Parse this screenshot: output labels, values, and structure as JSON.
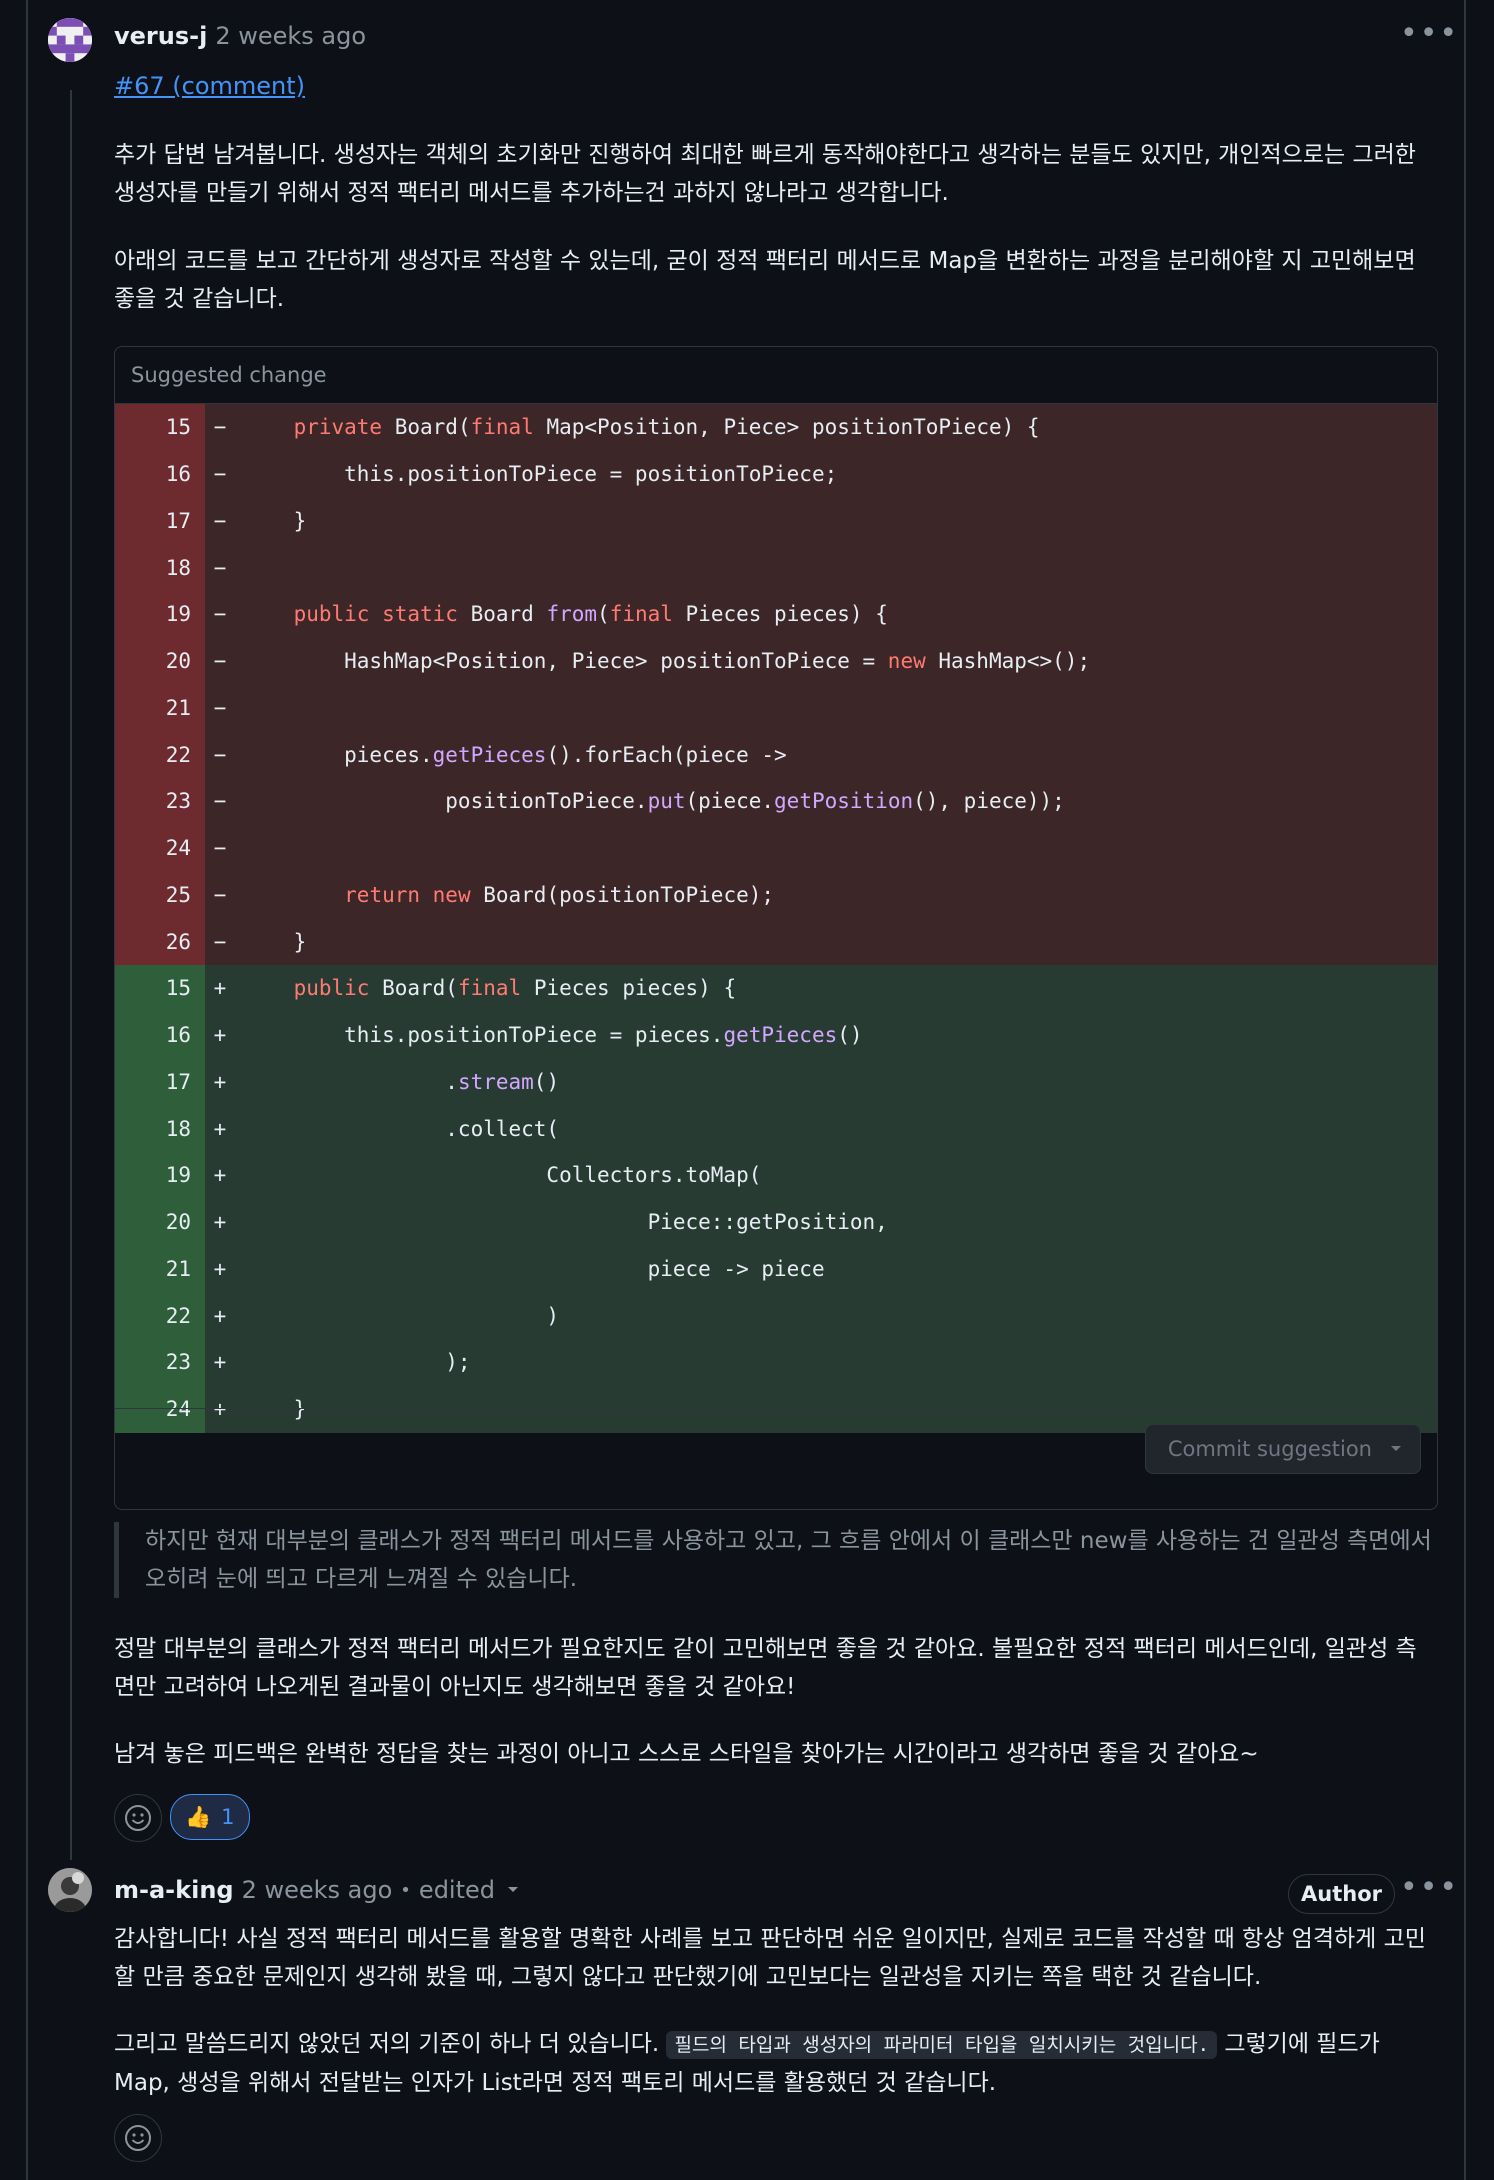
{
  "comment1": {
    "author": "verus-j",
    "time": "2 weeks ago",
    "link": "#67 (comment)",
    "para1": "추가 답변 남겨봅니다. 생성자는 객체의 초기화만 진행하여 최대한 빠르게 동작해야한다고 생각하는 분들도 있지만, 개인적으로는 그러한 생성자를 만들기 위해서 정적 팩터리 메서드를 추가하는건 과하지 않나라고 생각합니다.",
    "para2": "아래의 코드를 보고 간단하게 생성자로 작성할 수 있는데, 굳이 정적 팩터리 메서드로 Map을 변환하는 과정을 분리해야할 지 고민해보면 좋을 것 같습니다.",
    "suggestion": {
      "header": "Suggested change",
      "lines": [
        {
          "n": "15",
          "s": "−",
          "type": "del",
          "parts": [
            [
              "    ",
              ""
            ],
            [
              "private ",
              "kw"
            ],
            [
              "Board(",
              ""
            ],
            [
              "final ",
              "kw"
            ],
            [
              "Map<Position, Piece> positionToPiece) {",
              ""
            ]
          ]
        },
        {
          "n": "16",
          "s": "−",
          "type": "del",
          "parts": [
            [
              "        this.positionToPiece = positionToPiece;",
              ""
            ]
          ]
        },
        {
          "n": "17",
          "s": "−",
          "type": "del",
          "parts": [
            [
              "    }",
              ""
            ]
          ]
        },
        {
          "n": "18",
          "s": "−",
          "type": "del",
          "parts": [
            [
              "",
              ""
            ]
          ]
        },
        {
          "n": "19",
          "s": "−",
          "type": "del",
          "parts": [
            [
              "    ",
              ""
            ],
            [
              "public static ",
              "kw"
            ],
            [
              "Board ",
              ""
            ],
            [
              "from",
              "fn"
            ],
            [
              "(",
              ""
            ],
            [
              "final ",
              "kw"
            ],
            [
              "Pieces pieces) {",
              ""
            ]
          ]
        },
        {
          "n": "20",
          "s": "−",
          "type": "del",
          "parts": [
            [
              "        HashMap<Position, Piece> positionToPiece = ",
              ""
            ],
            [
              "new ",
              "kw"
            ],
            [
              "HashMap<>();",
              ""
            ]
          ]
        },
        {
          "n": "21",
          "s": "−",
          "type": "del",
          "parts": [
            [
              "",
              ""
            ]
          ]
        },
        {
          "n": "22",
          "s": "−",
          "type": "del",
          "parts": [
            [
              "        pieces.",
              ""
            ],
            [
              "getPieces",
              "fn"
            ],
            [
              "().forEach(piece ->",
              ""
            ]
          ]
        },
        {
          "n": "23",
          "s": "−",
          "type": "del",
          "parts": [
            [
              "                positionToPiece.",
              ""
            ],
            [
              "put",
              "fn"
            ],
            [
              "(piece.",
              ""
            ],
            [
              "getPosition",
              "fn"
            ],
            [
              "(), piece));",
              ""
            ]
          ]
        },
        {
          "n": "24",
          "s": "−",
          "type": "del",
          "parts": [
            [
              "",
              ""
            ]
          ]
        },
        {
          "n": "25",
          "s": "−",
          "type": "del",
          "parts": [
            [
              "        ",
              ""
            ],
            [
              "return new ",
              "kw"
            ],
            [
              "Board(positionToPiece);",
              ""
            ]
          ]
        },
        {
          "n": "26",
          "s": "−",
          "type": "del",
          "parts": [
            [
              "    }",
              ""
            ]
          ]
        },
        {
          "n": "15",
          "s": "+",
          "type": "add",
          "parts": [
            [
              "    ",
              ""
            ],
            [
              "public ",
              "kw"
            ],
            [
              "Board(",
              ""
            ],
            [
              "final ",
              "kw"
            ],
            [
              "Pieces pieces) {",
              ""
            ]
          ]
        },
        {
          "n": "16",
          "s": "+",
          "type": "add",
          "parts": [
            [
              "        this.positionToPiece = pieces.",
              ""
            ],
            [
              "getPieces",
              "fn"
            ],
            [
              "()",
              ""
            ]
          ]
        },
        {
          "n": "17",
          "s": "+",
          "type": "add",
          "parts": [
            [
              "                .",
              ""
            ],
            [
              "stream",
              "fn"
            ],
            [
              "()",
              ""
            ]
          ]
        },
        {
          "n": "18",
          "s": "+",
          "type": "add",
          "parts": [
            [
              "                .collect(",
              ""
            ]
          ]
        },
        {
          "n": "19",
          "s": "+",
          "type": "add",
          "parts": [
            [
              "                        Collectors.toMap(",
              ""
            ]
          ]
        },
        {
          "n": "20",
          "s": "+",
          "type": "add",
          "parts": [
            [
              "                                Piece::getPosition,",
              ""
            ]
          ]
        },
        {
          "n": "21",
          "s": "+",
          "type": "add",
          "parts": [
            [
              "                                piece -> piece",
              ""
            ]
          ]
        },
        {
          "n": "22",
          "s": "+",
          "type": "add",
          "parts": [
            [
              "                        )",
              ""
            ]
          ]
        },
        {
          "n": "23",
          "s": "+",
          "type": "add",
          "parts": [
            [
              "                );",
              ""
            ]
          ]
        },
        {
          "n": "24",
          "s": "+",
          "type": "add",
          "parts": [
            [
              "    }",
              ""
            ]
          ]
        }
      ],
      "commit_label": "Commit suggestion"
    },
    "quote": "하지만 현재 대부분의 클래스가 정적 팩터리 메서드를 사용하고 있고, 그 흐름 안에서 이 클래스만 new를 사용하는 건 일관성 측면에서 오히려 눈에 띄고 다르게 느껴질 수 있습니다.",
    "para3": "정말 대부분의 클래스가 정적 팩터리 메서드가 필요한지도 같이 고민해보면 좋을 것 같아요. 불필요한 정적 팩터리 메서드인데, 일관성 측면만 고려하여 나오게된 결과물이 아닌지도 생각해보면 좋을 것 같아요!",
    "para4": "남겨 놓은 피드백은 완벽한 정답을 찾는 과정이 아니고 스스로 스타일을 찾아가는 시간이라고 생각하면 좋을 것 같아요~",
    "reaction": {
      "emoji": "👍",
      "count": "1"
    }
  },
  "comment2": {
    "author": "m-a-king",
    "time": "2 weeks ago",
    "separator": "•",
    "edited": "edited",
    "badge": "Author",
    "para1": "감사합니다! 사실 정적 팩터리 메서드를 활용할 명확한 사례를 보고 판단하면 쉬운 일이지만, 실제로 코드를 작성할 때 항상 엄격하게 고민할 만큼 중요한 문제인지 생각해 봤을 때, 그렇지 않다고 판단했기에 고민보다는 일관성을 지키는 쪽을 택한 것 같습니다.",
    "para2_before": "그리고 말씀드리지 않았던 저의 기준이 하나 더 있습니다. ",
    "para2_code": "필드의 타입과 생성자의 파라미터 타입을 일치시키는 것입니다.",
    "para2_after": " 그렇기에 필드가 Map, 생성을 위해서 전달받는 인자가 List라면 정적 팩토리 메서드를 활용했던 것 같습니다."
  },
  "icons": {
    "more": "kebab-icon",
    "smiley": "smiley-icon",
    "caret": "caret-down-icon"
  }
}
